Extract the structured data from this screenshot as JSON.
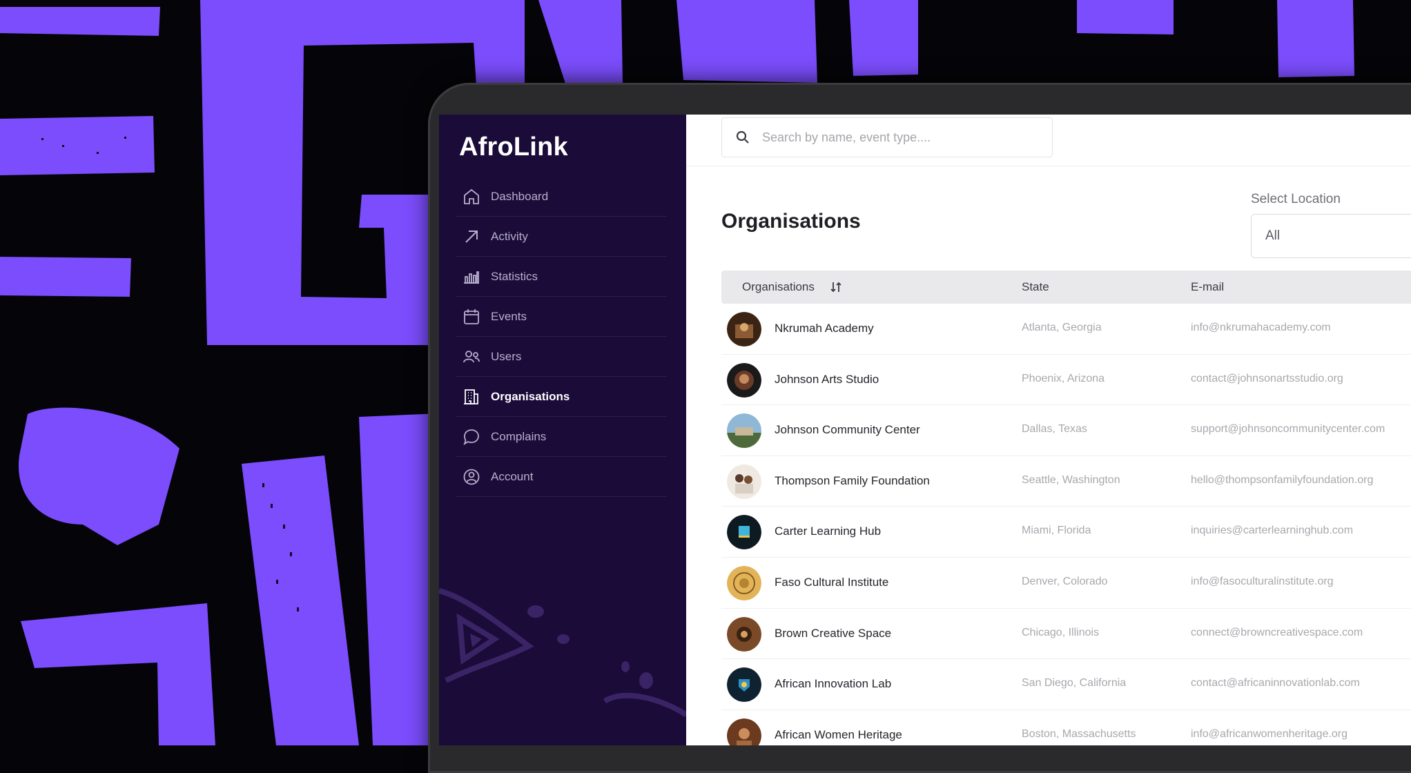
{
  "app": {
    "brand": "AfroLink"
  },
  "search": {
    "placeholder": "Search by name, event type...."
  },
  "sidebar": {
    "items": [
      {
        "label": "Dashboard",
        "icon": "home-icon",
        "active": false
      },
      {
        "label": "Activity",
        "icon": "arrow-up-right-icon",
        "active": false
      },
      {
        "label": "Statistics",
        "icon": "bar-chart-icon",
        "active": false
      },
      {
        "label": "Events",
        "icon": "calendar-icon",
        "active": false
      },
      {
        "label": "Users",
        "icon": "users-icon",
        "active": false
      },
      {
        "label": "Organisations",
        "icon": "building-icon",
        "active": true
      },
      {
        "label": "Complains",
        "icon": "chat-bubble-icon",
        "active": false
      },
      {
        "label": "Account",
        "icon": "user-circle-icon",
        "active": false
      }
    ]
  },
  "main": {
    "title": "Organisations",
    "location": {
      "label": "Select Location",
      "value": "All"
    },
    "table": {
      "headers": {
        "organisation": "Organisations",
        "state": "State",
        "email": "E-mail"
      },
      "rows": [
        {
          "name": "Nkrumah Academy",
          "state": "Atlanta, Georgia",
          "email": "info@nkrumahacademy.com"
        },
        {
          "name": "Johnson Arts Studio",
          "state": "Phoenix, Arizona",
          "email": "contact@johnsonartsstudio.org"
        },
        {
          "name": "Johnson Community Center",
          "state": "Dallas, Texas",
          "email": "support@johnsoncommunitycenter.com"
        },
        {
          "name": "Thompson Family Foundation",
          "state": "Seattle, Washington",
          "email": "hello@thompsonfamilyfoundation.org"
        },
        {
          "name": "Carter Learning Hub",
          "state": "Miami, Florida",
          "email": "inquiries@carterlearninghub.com"
        },
        {
          "name": "Faso Cultural Institute",
          "state": "Denver, Colorado",
          "email": "info@fasoculturalinstitute.org"
        },
        {
          "name": "Brown Creative Space",
          "state": "Chicago, Illinois",
          "email": "connect@browncreativespace.com"
        },
        {
          "name": "African Innovation Lab",
          "state": "San Diego, California",
          "email": "contact@africaninnovationlab.com"
        },
        {
          "name": "African Women Heritage",
          "state": "Boston, Massachusetts",
          "email": "info@africanwomenheritage.org"
        }
      ]
    }
  },
  "colors": {
    "accent_purple": "#7b4dfc",
    "sidebar_bg": "#1a0b38",
    "page_bg": "#050408"
  }
}
